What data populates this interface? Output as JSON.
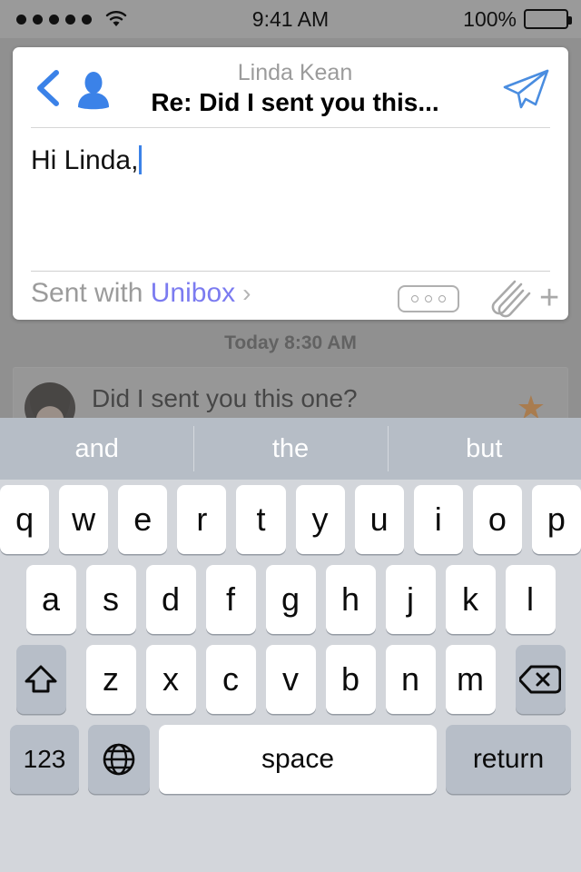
{
  "status_bar": {
    "signal_dots": 5,
    "wifi_icon": "wifi-icon",
    "time": "9:41 AM",
    "battery_percent": "100%",
    "battery_icon": "battery-full-icon"
  },
  "compose": {
    "back_icon": "back-chevron-icon",
    "contact_icon": "person-icon",
    "recipient": "Linda Kean",
    "subject": "Re: Did I sent you this...",
    "send_icon": "send-paper-plane-icon",
    "body_text": "Hi Linda,",
    "signature_prefix": "Sent with",
    "signature_brand": "Unibox",
    "signature_chevron": "›",
    "more_options_icon": "more-options-icon",
    "attachment_icon": "paperclip-icon",
    "add_icon": "plus-icon",
    "accent_color": "#3b82e8",
    "brand_color": "#7b7bf0"
  },
  "background": {
    "date_separator": "Today 8:30 AM",
    "message": {
      "avatar": "contact-avatar",
      "text": "Did I sent you this one?",
      "star_icon": "star-icon",
      "star_color": "#c4782a"
    }
  },
  "keyboard": {
    "predictions": [
      "and",
      "the",
      "but"
    ],
    "row1": [
      "q",
      "w",
      "e",
      "r",
      "t",
      "y",
      "u",
      "i",
      "o",
      "p"
    ],
    "row2": [
      "a",
      "s",
      "d",
      "f",
      "g",
      "h",
      "j",
      "k",
      "l"
    ],
    "row3": [
      "z",
      "x",
      "c",
      "v",
      "b",
      "n",
      "m"
    ],
    "shift_icon": "shift-icon",
    "backspace_icon": "backspace-icon",
    "numbers_key": "123",
    "globe_icon": "globe-icon",
    "space_key": "space",
    "return_key": "return"
  }
}
